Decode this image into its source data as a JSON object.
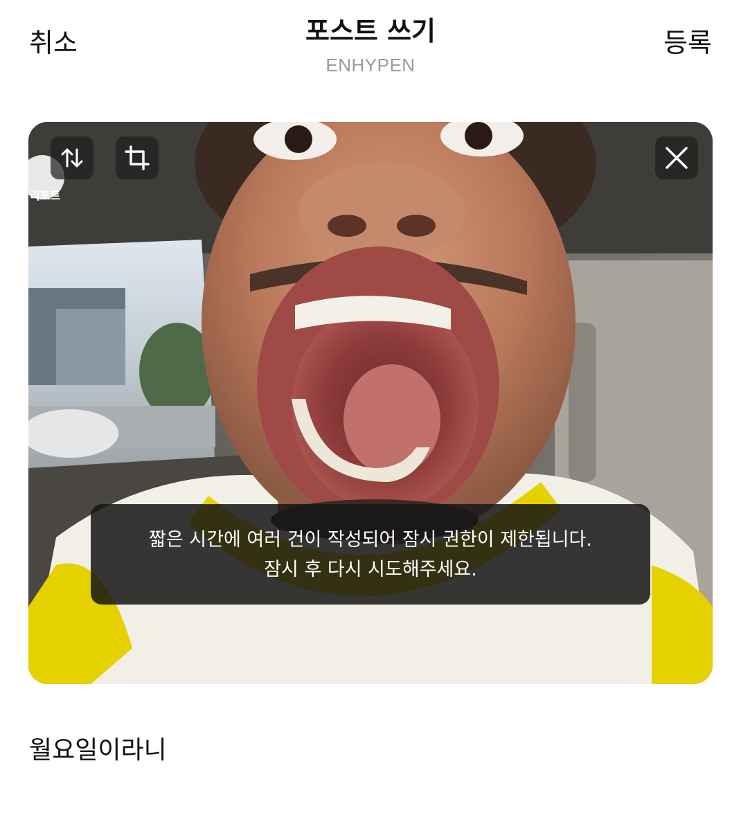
{
  "header": {
    "cancel_label": "취소",
    "title": "포스트 쓰기",
    "subtitle": "ENHYPEN",
    "submit_label": "등록"
  },
  "media": {
    "buttons": {
      "reorder_icon": "swap-vertical-icon",
      "crop_icon": "crop-icon",
      "close_icon": "close-icon"
    },
    "photo_watermark": "리포트"
  },
  "toast": {
    "line1": "짧은 시간에 여러 건이 작성되어 잠시 권한이 제한됩니다.",
    "line2": "잠시 후 다시 시도해주세요."
  },
  "post": {
    "text": "월요일이라니"
  },
  "colors": {
    "text": "#111111",
    "subtitle": "#9a9a9a",
    "button_bg": "#1e1e1e",
    "toast_bg": "#161616"
  }
}
